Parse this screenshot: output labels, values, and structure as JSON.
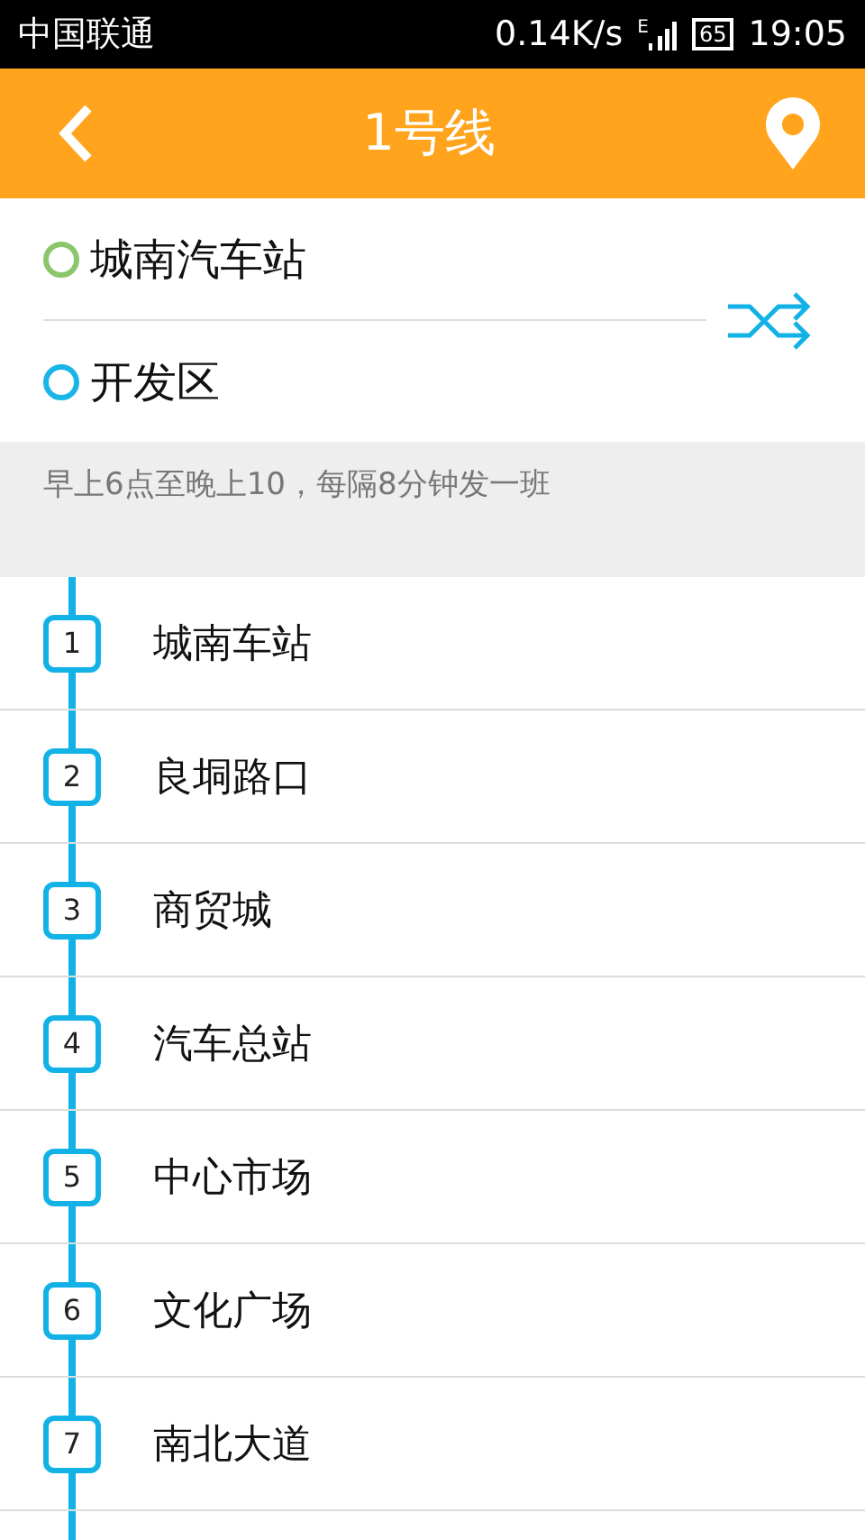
{
  "status_bar": {
    "carrier": "中国联通",
    "speed": "0.14K/s",
    "network": "E",
    "battery": "65",
    "time": "19:05"
  },
  "header": {
    "title": "1号线"
  },
  "route": {
    "from": {
      "name": "城南汽车站",
      "color": "#8cc66a"
    },
    "to": {
      "name": "开发区",
      "color": "#1ab5e8"
    }
  },
  "schedule": "早上6点至晚上10，每隔8分钟发一班",
  "stops": [
    {
      "number": "1",
      "name": "城南车站"
    },
    {
      "number": "2",
      "name": "良垌路口"
    },
    {
      "number": "3",
      "name": "商贸城"
    },
    {
      "number": "4",
      "name": "汽车总站"
    },
    {
      "number": "5",
      "name": "中心市场"
    },
    {
      "number": "6",
      "name": "文化广场"
    },
    {
      "number": "7",
      "name": "南北大道"
    }
  ]
}
